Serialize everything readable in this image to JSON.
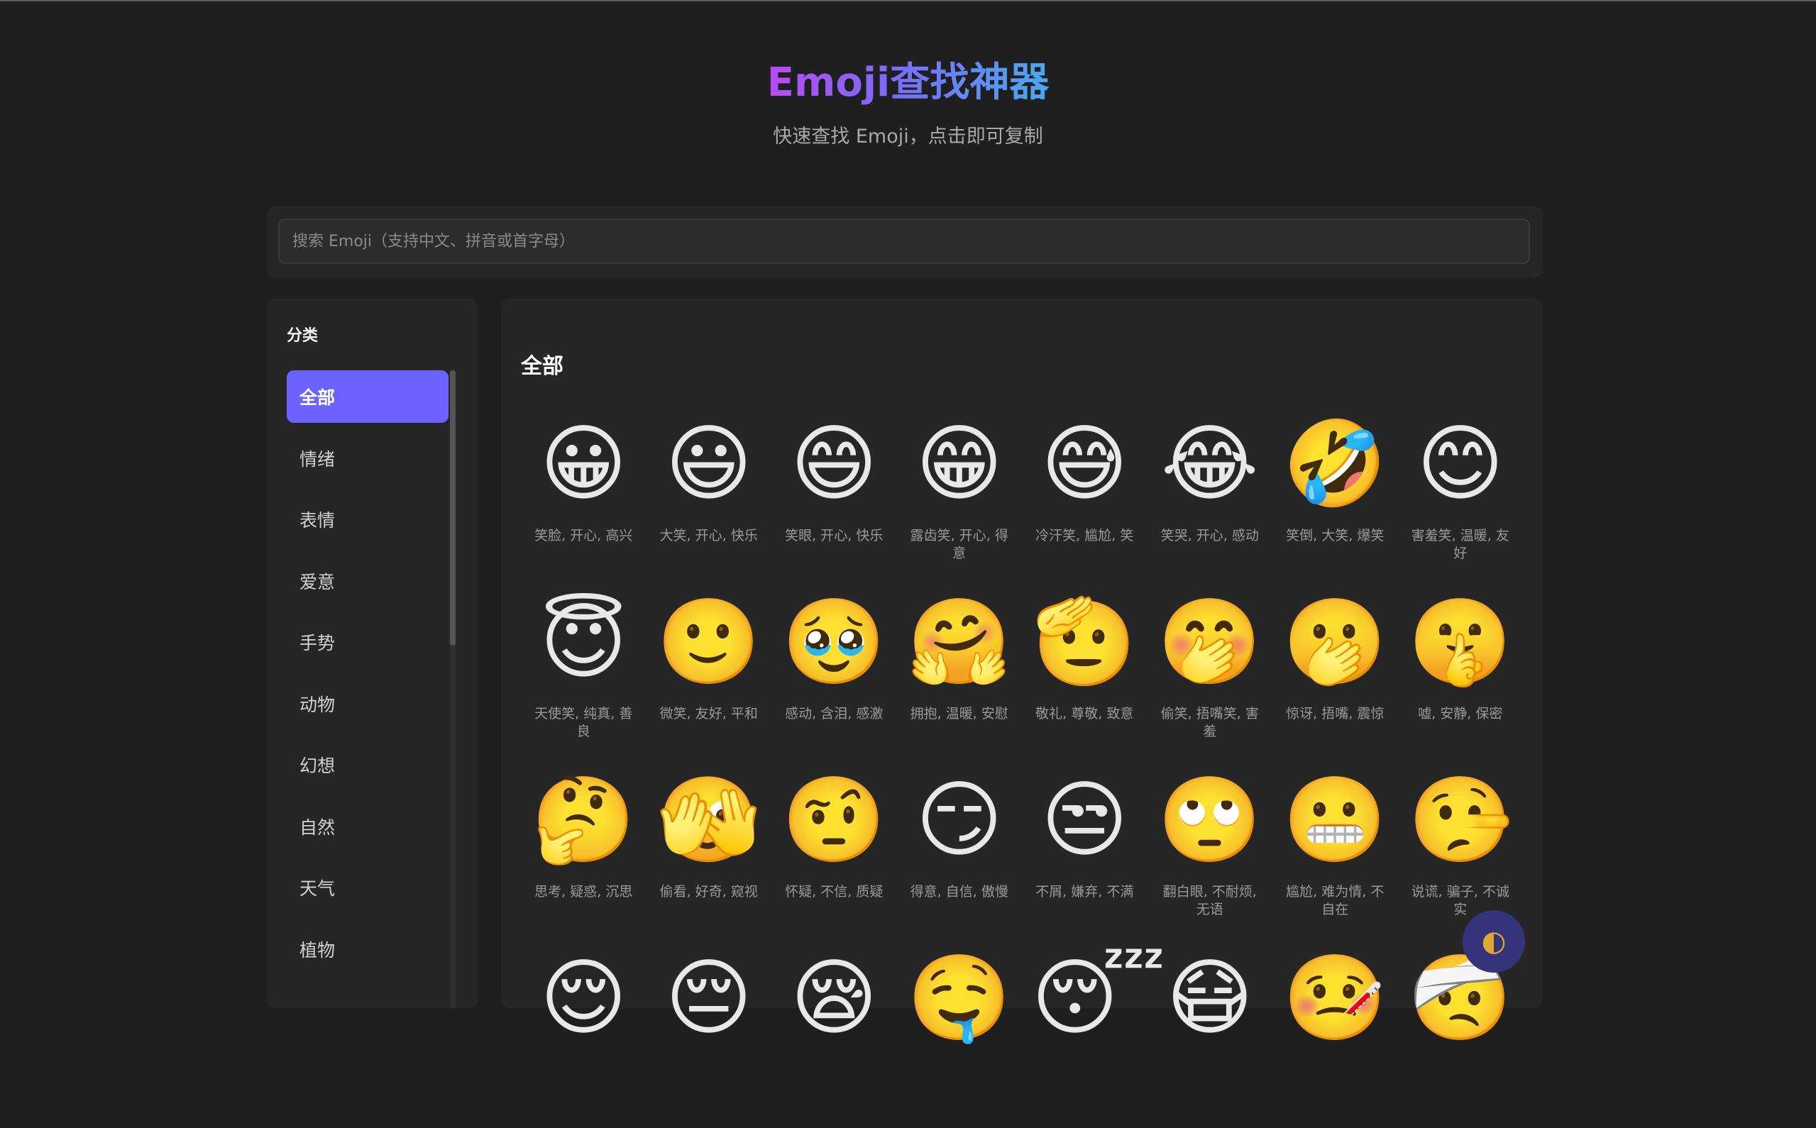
{
  "header": {
    "title": "Emoji查找神器",
    "subtitle": "快速查找 Emoji，点击即可复制"
  },
  "search": {
    "placeholder": "搜索 Emoji（支持中文、拼音或首字母）",
    "value": ""
  },
  "sidebar": {
    "title": "分类",
    "items": [
      "全部",
      "情绪",
      "表情",
      "爱意",
      "手势",
      "动物",
      "幻想",
      "自然",
      "天气",
      "植物"
    ],
    "active": "全部"
  },
  "main": {
    "section_title": "全部",
    "emojis": [
      {
        "char": "😀",
        "label": "笑脸, 开心, 高兴"
      },
      {
        "char": "😃",
        "label": "大笑, 开心, 快乐"
      },
      {
        "char": "😄",
        "label": "笑眼, 开心, 快乐"
      },
      {
        "char": "😁",
        "label": "露齿笑, 开心, 得意"
      },
      {
        "char": "😅",
        "label": "冷汗笑, 尴尬, 笑"
      },
      {
        "char": "😂",
        "label": "笑哭, 开心, 感动"
      },
      {
        "char": "🤣",
        "label": "笑倒, 大笑, 爆笑"
      },
      {
        "char": "😊",
        "label": "害羞笑, 温暖, 友好"
      },
      {
        "char": "😇",
        "label": "天使笑, 纯真, 善良"
      },
      {
        "char": "🙂",
        "label": "微笑, 友好, 平和"
      },
      {
        "char": "🥹",
        "label": "感动, 含泪, 感激"
      },
      {
        "char": "🤗",
        "label": "拥抱, 温暖, 安慰"
      },
      {
        "char": "🫡",
        "label": "敬礼, 尊敬, 致意"
      },
      {
        "char": "🤭",
        "label": "偷笑, 捂嘴笑, 害羞"
      },
      {
        "char": "🫢",
        "label": "惊讶, 捂嘴, 震惊"
      },
      {
        "char": "🤫",
        "label": "嘘, 安静, 保密"
      },
      {
        "char": "🤔",
        "label": "思考, 疑惑, 沉思"
      },
      {
        "char": "🫣",
        "label": "偷看, 好奇, 窥视"
      },
      {
        "char": "🤨",
        "label": "怀疑, 不信, 质疑"
      },
      {
        "char": "😏",
        "label": "得意, 自信, 傲慢"
      },
      {
        "char": "😒",
        "label": "不屑, 嫌弃, 不满"
      },
      {
        "char": "🙄",
        "label": "翻白眼, 不耐烦, 无语"
      },
      {
        "char": "😬",
        "label": "尴尬, 难为情, 不自在"
      },
      {
        "char": "🤥",
        "label": "说谎, 骗子, 不诚实"
      },
      {
        "char": "😌",
        "label": ""
      },
      {
        "char": "😔",
        "label": ""
      },
      {
        "char": "😪",
        "label": ""
      },
      {
        "char": "🤤",
        "label": ""
      },
      {
        "char": "😴",
        "label": ""
      },
      {
        "char": "😷",
        "label": ""
      },
      {
        "char": "🤒",
        "label": ""
      },
      {
        "char": "🤕",
        "label": ""
      }
    ]
  },
  "theme_toggle": {
    "icon": "◐"
  }
}
